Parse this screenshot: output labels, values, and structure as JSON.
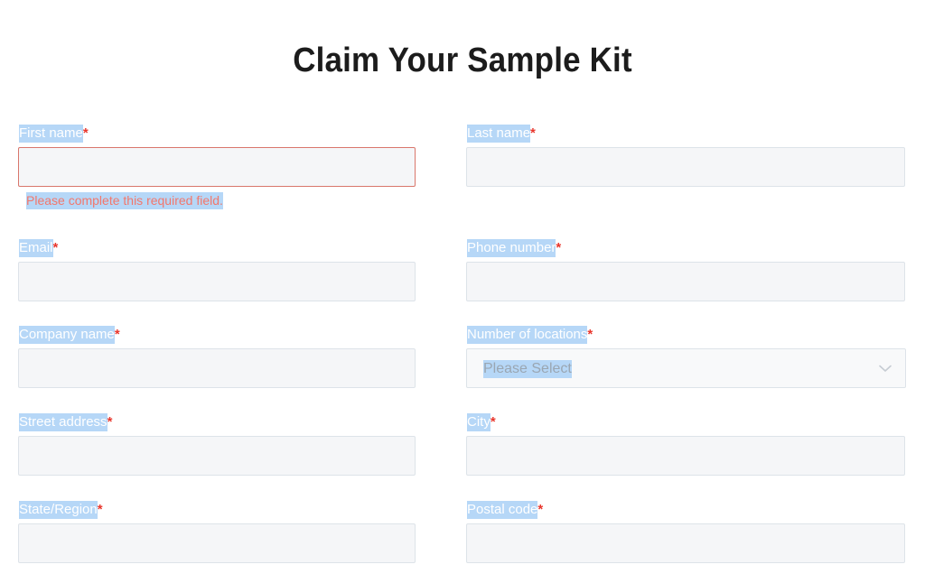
{
  "page": {
    "title": "Claim Your Sample Kit",
    "required_marker": "*"
  },
  "colors": {
    "selection_highlight": "#b6d7f7",
    "required_asterisk": "#e8362c",
    "error_text": "#f2776c",
    "error_border": "#d9776c",
    "input_border": "#dde3e9",
    "input_background": "#f5f6f8",
    "title_text": "#1c1c1c",
    "placeholder_text": "#9aa6b2"
  },
  "form": {
    "rows": [
      {
        "left": {
          "label": "First name",
          "required": true,
          "type": "text",
          "value": "",
          "state": "error",
          "error": "Please complete this required field."
        },
        "right": {
          "label": "Last name",
          "required": true,
          "type": "text",
          "value": "",
          "state": "normal"
        }
      },
      {
        "left": {
          "label": "Email",
          "required": true,
          "type": "text",
          "value": "",
          "state": "normal"
        },
        "right": {
          "label": "Phone number",
          "required": true,
          "type": "text",
          "value": "",
          "state": "normal"
        }
      },
      {
        "left": {
          "label": "Company name",
          "required": true,
          "type": "text",
          "value": "",
          "state": "normal"
        },
        "right": {
          "label": "Number of locations",
          "required": true,
          "type": "select",
          "value": "Please Select",
          "state": "normal",
          "icon": "chevron-down-icon"
        }
      },
      {
        "left": {
          "label": "Street address",
          "required": true,
          "type": "text",
          "value": "",
          "state": "normal"
        },
        "right": {
          "label": "City",
          "required": true,
          "type": "text",
          "value": "",
          "state": "normal"
        }
      },
      {
        "left": {
          "label": "State/Region",
          "required": true,
          "type": "text",
          "value": "",
          "state": "normal"
        },
        "right": {
          "label": "Postal code",
          "required": true,
          "type": "text",
          "value": "",
          "state": "normal"
        }
      }
    ]
  }
}
